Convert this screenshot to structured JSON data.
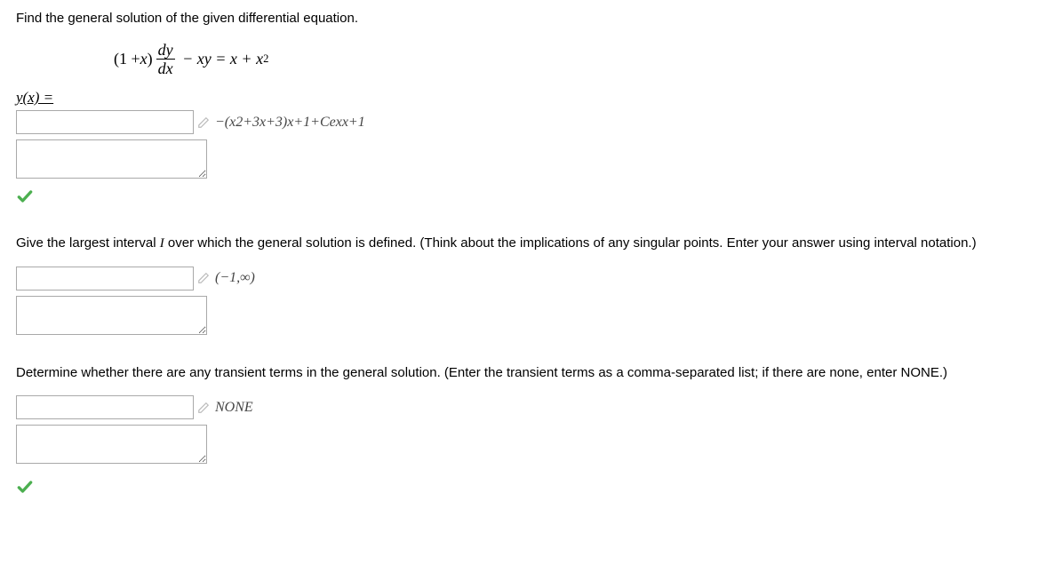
{
  "q1": {
    "prompt": "Find the general solution of the given differential equation.",
    "equation_label": "equation",
    "yx_label": "y(x) =",
    "solution": "−(x2+3x+3)x+1+Cexx+1"
  },
  "q2": {
    "prompt_pre": "Give the largest interval ",
    "prompt_italic": "I",
    "prompt_post": " over which the general solution is defined. (Think about the implications of any singular points. Enter your answer using interval notation.)",
    "solution": "(−1,∞)"
  },
  "q3": {
    "prompt": "Determine whether there are any transient terms in the general solution. (Enter the transient terms as a comma-separated list; if there are none, enter NONE.)",
    "solution": "NONE"
  }
}
